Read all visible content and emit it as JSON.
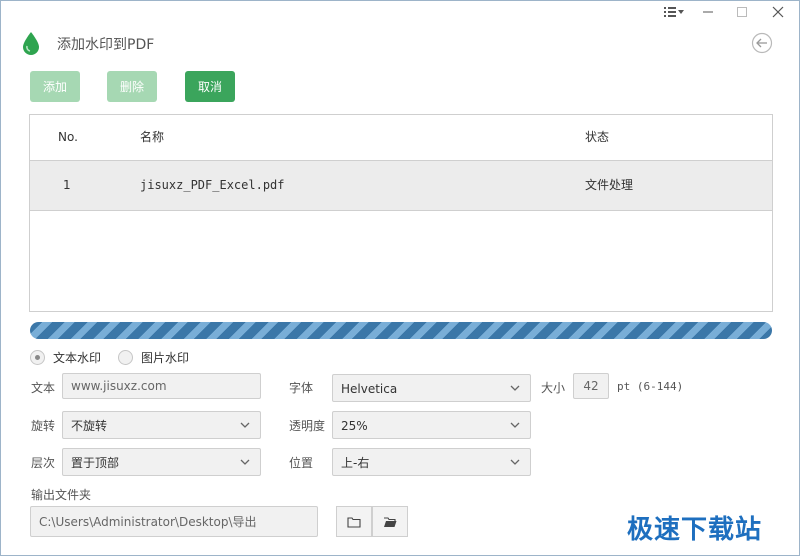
{
  "window": {
    "title": "添加水印到PDF",
    "accent": "#3ba55c",
    "icons": {
      "app": "water-drop-icon",
      "menu": "menu-icon",
      "minimize": "minimize-icon",
      "maximize": "maximize-icon",
      "close": "close-icon",
      "back": "back-arrow-icon"
    }
  },
  "toolbar": {
    "add_label": "添加",
    "delete_label": "删除",
    "cancel_label": "取消"
  },
  "table": {
    "columns": [
      "No.",
      "名称",
      "状态"
    ],
    "rows": [
      {
        "no": "1",
        "name": "jisuxz_PDF_Excel.pdf",
        "status": "文件处理"
      }
    ]
  },
  "progress": {
    "percent": 100
  },
  "watermark_mode": {
    "text_label": "文本水印",
    "image_label": "图片水印",
    "selected": "text"
  },
  "form": {
    "text_label": "文本",
    "text_value": "www.jisuxz.com",
    "font_label": "字体",
    "font_value": "Helvetica",
    "size_label": "大小",
    "size_value": "42",
    "size_unit": "pt (6-144)",
    "rotate_label": "旋转",
    "rotate_value": "不旋转",
    "opacity_label": "透明度",
    "opacity_value": "25%",
    "layer_label": "层次",
    "layer_value": "置于顶部",
    "position_label": "位置",
    "position_value": "上-右",
    "output_label": "输出文件夹",
    "output_value": "C:\\Users\\Administrator\\Desktop\\导出"
  },
  "brand_watermark": "极速下载站"
}
